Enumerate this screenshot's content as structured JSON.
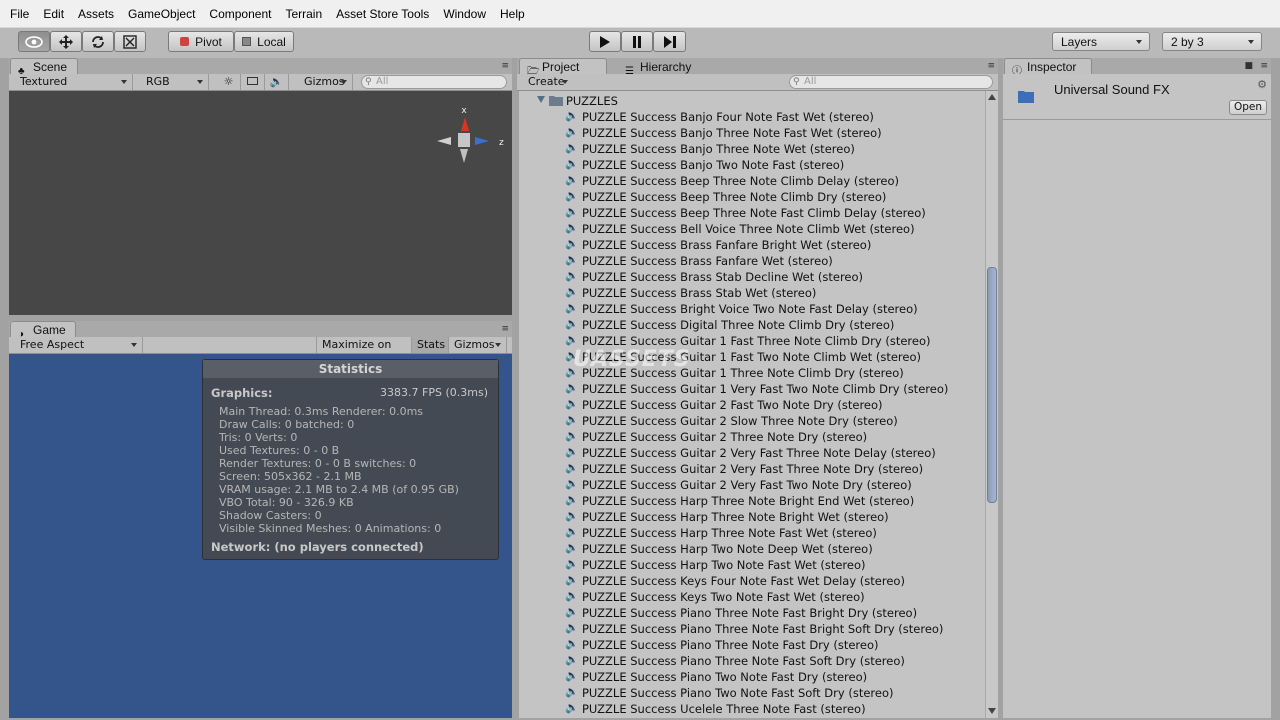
{
  "menu": [
    "File",
    "Edit",
    "Assets",
    "GameObject",
    "Component",
    "Terrain",
    "Asset Store Tools",
    "Window",
    "Help"
  ],
  "toolbar": {
    "pivot_label": "Pivot",
    "local_label": "Local",
    "layers_label": "Layers",
    "layout_label": "2 by 3"
  },
  "scene": {
    "tab_label": "Scene",
    "shading": "Textured",
    "channel": "RGB",
    "gizmos_label": "Gizmos",
    "search_placeholder": "All",
    "axis_x": "x",
    "axis_z": "z"
  },
  "game": {
    "tab_label": "Game",
    "aspect": "Free Aspect",
    "maximize_label": "Maximize on Play",
    "stats_label": "Stats",
    "gizmos_label": "Gizmos",
    "statistics": {
      "title": "Statistics",
      "graphics_label": "Graphics:",
      "fps": "3383.7 FPS (0.3ms)",
      "lines": [
        "Main Thread: 0.3ms  Renderer: 0.0ms",
        "Draw Calls: 0   batched: 0",
        "Tris: 0     Verts: 0",
        "Used Textures: 0 - 0 B",
        "Render Textures: 0 - 0 B  switches: 0",
        "Screen: 505x362 - 2.1 MB",
        "VRAM usage: 2.1 MB to 2.4 MB (of 0.95 GB)",
        "VBO Total: 90 - 326.9 KB",
        "Shadow Casters: 0",
        "Visible Skinned Meshes: 0     Animations: 0"
      ],
      "network": "Network: (no players connected)"
    }
  },
  "project": {
    "tab_label": "Project",
    "hierarchy_label": "Hierarchy",
    "create_label": "Create",
    "search_placeholder": "All",
    "folder": "PUZZLES",
    "watermark": "UASSETS",
    "assets": [
      "PUZZLE Success Banjo Four Note Fast Wet (stereo)",
      "PUZZLE Success Banjo Three Note Fast Wet (stereo)",
      "PUZZLE Success Banjo Three Note Wet (stereo)",
      "PUZZLE Success Banjo Two Note Fast (stereo)",
      "PUZZLE Success Beep Three Note Climb Delay  (stereo)",
      "PUZZLE Success Beep Three Note Climb Dry (stereo)",
      "PUZZLE Success Beep Three Note Fast Climb Delay (stereo)",
      "PUZZLE Success Bell Voice Three Note Climb Wet (stereo)",
      "PUZZLE Success Brass Fanfare Bright Wet (stereo)",
      "PUZZLE Success Brass Fanfare Wet (stereo)",
      "PUZZLE Success Brass Stab Decline Wet (stereo)",
      "PUZZLE Success Brass Stab Wet (stereo)",
      "PUZZLE Success Bright Voice Two Note Fast Delay (stereo)",
      "PUZZLE Success Digital Three Note Climb Dry (stereo)",
      "PUZZLE Success Guitar 1 Fast Three Note Climb Dry (stereo)",
      "PUZZLE Success Guitar 1 Fast Two Note Climb Wet (stereo)",
      "PUZZLE Success Guitar 1 Three Note Climb Dry (stereo)",
      "PUZZLE Success Guitar 1 Very Fast Two Note Climb Dry (stereo)",
      "PUZZLE Success Guitar 2 Fast Two Note Dry (stereo)",
      "PUZZLE Success Guitar 2 Slow Three Note Dry (stereo)",
      "PUZZLE Success Guitar 2 Three Note Dry (stereo)",
      "PUZZLE Success Guitar 2 Very Fast Three Note Delay (stereo)",
      "PUZZLE Success Guitar 2 Very Fast Three Note Dry (stereo)",
      "PUZZLE Success Guitar 2 Very Fast Two Note Dry (stereo)",
      "PUZZLE Success Harp Three Note Bright End Wet (stereo)",
      "PUZZLE Success Harp Three Note Bright Wet (stereo)",
      "PUZZLE Success Harp Three Note Fast Wet (stereo)",
      "PUZZLE Success Harp Two Note Deep Wet (stereo)",
      "PUZZLE Success Harp Two Note Fast Wet (stereo)",
      "PUZZLE Success Keys Four Note Fast Wet Delay (stereo)",
      "PUZZLE Success Keys Two Note Fast Wet (stereo)",
      "PUZZLE Success Piano Three Note Fast Bright Dry (stereo)",
      "PUZZLE Success Piano Three Note Fast Bright Soft Dry (stereo)",
      "PUZZLE Success Piano Three Note Fast Dry (stereo)",
      "PUZZLE Success Piano Three Note Fast Soft Dry (stereo)",
      "PUZZLE Success Piano Two Note Fast Dry (stereo)",
      "PUZZLE Success Piano Two Note Fast Soft Dry (stereo)",
      "PUZZLE Success Ucelele Three Note Fast (stereo)"
    ]
  },
  "inspector": {
    "tab_label": "Inspector",
    "object_name": "Universal Sound FX",
    "open_label": "Open"
  },
  "colors": {
    "scene_bg": "#474747",
    "game_bg": "#34558b",
    "panel_bg": "#c4c4c4",
    "accent": "#3d6fb6"
  },
  "icons": {
    "audio": "speaker-icon",
    "folder": "folder-icon"
  }
}
